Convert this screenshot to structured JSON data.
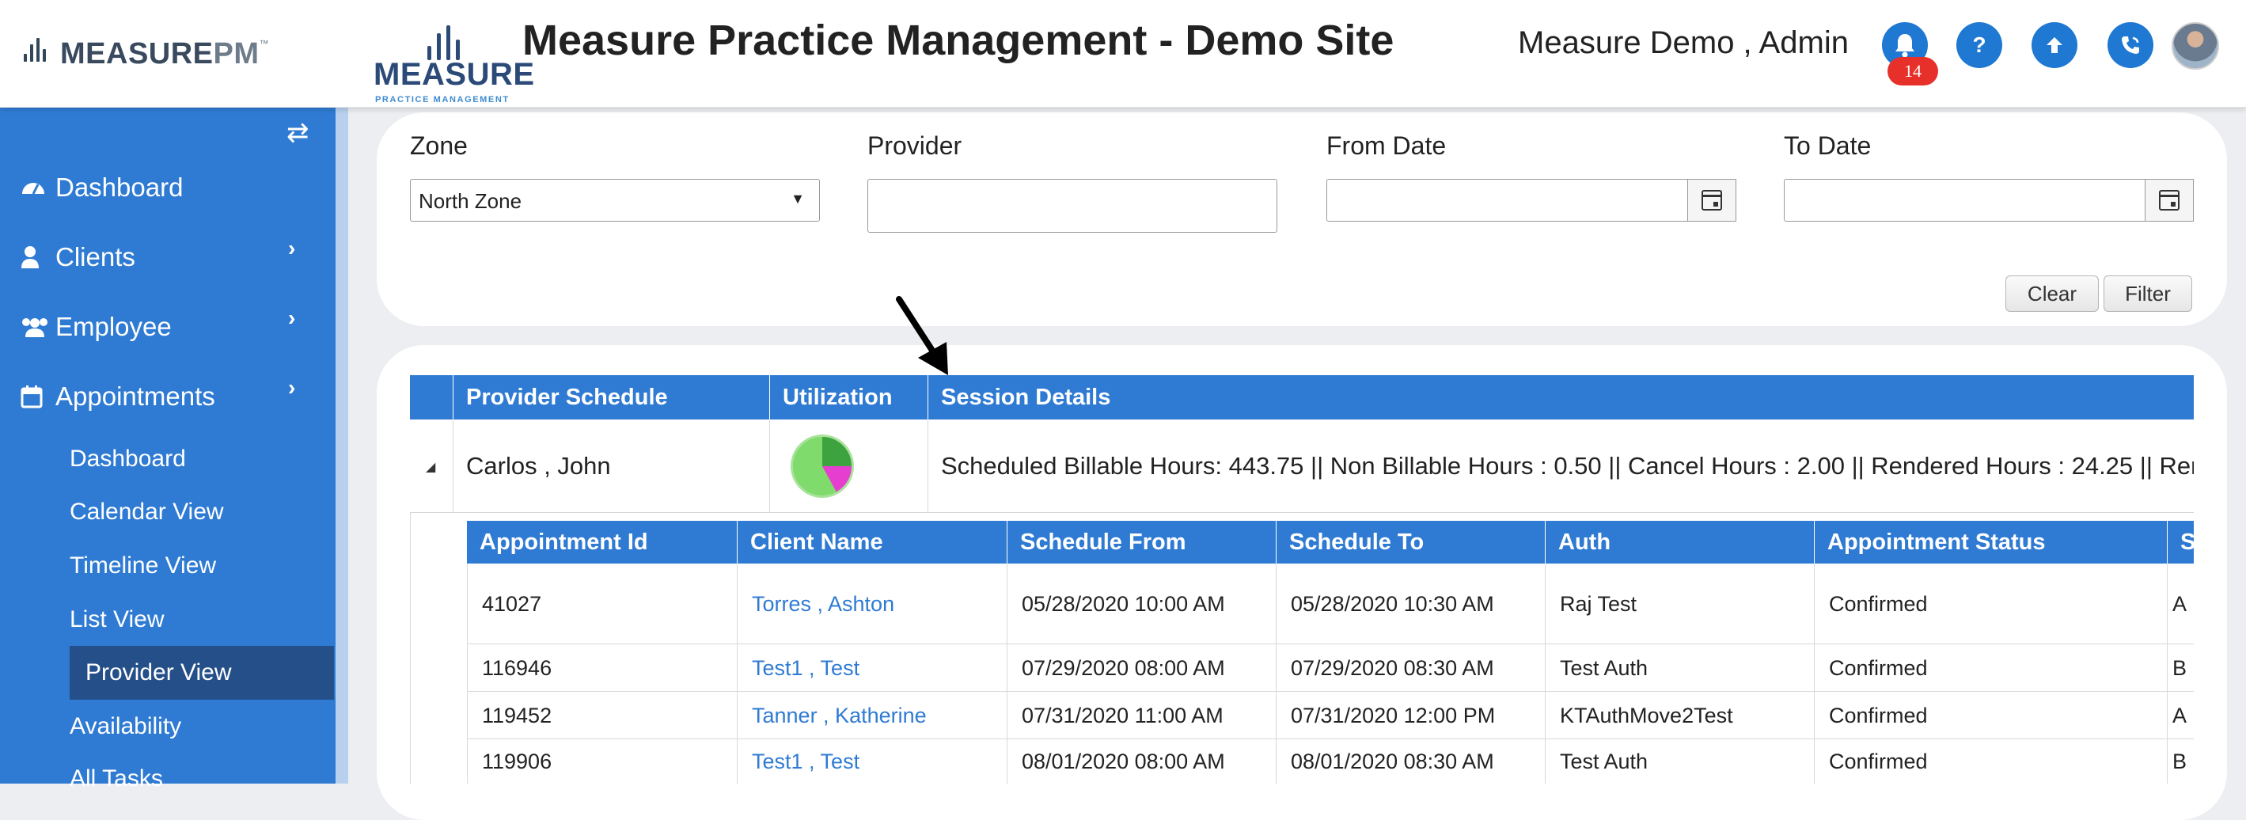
{
  "header": {
    "brand_main": "MEASURE",
    "brand_accent": "PM",
    "brand_tm": "™",
    "logo_word": "MEASURE",
    "logo_sub": "PRACTICE MANAGEMENT",
    "site_title": "Measure Practice Management - Demo Site",
    "user": "Measure Demo , Admin",
    "notifications_count": "14",
    "icons": [
      "bell-icon",
      "help-icon",
      "upload-icon",
      "phone-icon"
    ]
  },
  "sidebar": {
    "toggle_icon": "⇄",
    "items": [
      {
        "label": "Dashboard",
        "icon": "dashboard-icon"
      },
      {
        "label": "Clients",
        "icon": "user-icon"
      },
      {
        "label": "Employee",
        "icon": "users-icon"
      },
      {
        "label": "Appointments",
        "icon": "calendar-icon"
      }
    ],
    "sub_items": [
      "Dashboard",
      "Calendar View",
      "Timeline View",
      "List View",
      "Provider View",
      "Availability",
      "All Tasks"
    ],
    "active_sub": "Provider View"
  },
  "filters": {
    "zone_label": "Zone",
    "zone_value": "North Zone",
    "provider_label": "Provider",
    "provider_value": "",
    "from_label": "From Date",
    "from_value": "",
    "to_label": "To Date",
    "to_value": "",
    "clear_label": "Clear",
    "filter_label": "Filter"
  },
  "grid": {
    "columns": [
      "Provider Schedule",
      "Utilization",
      "Session Details"
    ],
    "row": {
      "provider": "Carlos , John",
      "session": "Scheduled Billable Hours: 443.75 || Non Billable Hours : 0.50 || Cancel Hours : 2.00 || Rendered Hours : 24.25 || Rend"
    },
    "inner_columns": [
      "Appointment Id",
      "Client Name",
      "Schedule From",
      "Schedule To",
      "Auth",
      "Appointment Status",
      "S"
    ],
    "inner_rows": [
      {
        "id": "41027",
        "client": "Torres , Ashton",
        "from": "05/28/2020 10:00 AM",
        "to": "05/28/2020 10:30 AM",
        "auth": "Raj Test",
        "status": "Confirmed",
        "extra": "A"
      },
      {
        "id": "116946",
        "client": "Test1 , Test",
        "from": "07/29/2020 08:00 AM",
        "to": "07/29/2020 08:30 AM",
        "auth": "Test Auth",
        "status": "Confirmed",
        "extra": "B"
      },
      {
        "id": "119452",
        "client": "Tanner , Katherine",
        "from": "07/31/2020 11:00 AM",
        "to": "07/31/2020 12:00 PM",
        "auth": "KTAuthMove2Test",
        "status": "Confirmed",
        "extra": "A"
      },
      {
        "id": "119906",
        "client": "Test1 , Test",
        "from": "08/01/2020 08:00 AM",
        "to": "08/01/2020 08:30 AM",
        "auth": "Test Auth",
        "status": "Confirmed",
        "extra": "B"
      }
    ]
  },
  "colors": {
    "primary": "#2f7bd3",
    "sidebar_active": "#244f88",
    "badge": "#e8302a",
    "link": "#2f7bd3"
  }
}
